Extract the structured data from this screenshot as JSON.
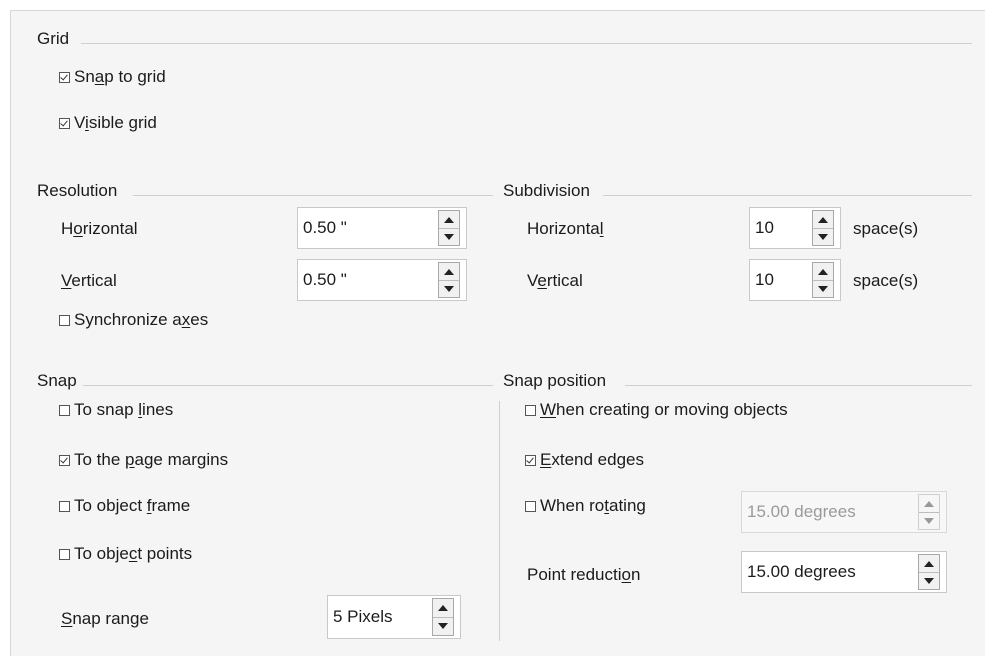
{
  "grid": {
    "title": "Grid",
    "snap_to_grid": {
      "pre": "Sn",
      "u": "a",
      "post": "p to grid",
      "checked": true
    },
    "visible_grid": {
      "pre": "V",
      "u": "i",
      "post": "sible grid",
      "checked": true
    }
  },
  "resolution": {
    "title": "Resolution",
    "horizontal": {
      "pre": "H",
      "u": "o",
      "post": "rizontal",
      "value": "0.50 \""
    },
    "vertical": {
      "pre": "",
      "u": "V",
      "post": "ertical",
      "value": "0.50 \""
    },
    "synchronize": {
      "pre": "Synchronize a",
      "u": "x",
      "post": "es",
      "checked": false
    }
  },
  "subdivision": {
    "title": "Subdivision",
    "horizontal": {
      "pre": "Horizonta",
      "u": "l",
      "post": "",
      "value": "10",
      "unit": "space(s)"
    },
    "vertical": {
      "pre": "V",
      "u": "e",
      "post": "rtical",
      "value": "10",
      "unit": "space(s)"
    }
  },
  "snap": {
    "title": "Snap",
    "snap_lines": {
      "pre": "To snap ",
      "u": "l",
      "post": "ines",
      "checked": false
    },
    "page_margins": {
      "pre": "To the ",
      "u": "p",
      "post": "age margins",
      "checked": true
    },
    "object_frame": {
      "pre": "To object ",
      "u": "f",
      "post": "rame",
      "checked": false
    },
    "object_points": {
      "pre": "To obje",
      "u": "c",
      "post": "t points",
      "checked": false
    },
    "range": {
      "pre": "",
      "u": "S",
      "post": "nap range",
      "value": "5 Pixels"
    }
  },
  "snap_position": {
    "title": "Snap position",
    "creating_moving": {
      "pre": "",
      "u": "W",
      "post": "hen creating or moving objects",
      "checked": false
    },
    "extend_edges": {
      "pre": "",
      "u": "E",
      "post": "xtend edges",
      "checked": true
    },
    "rotating": {
      "pre": "When ro",
      "u": "t",
      "post": "ating",
      "checked": false,
      "value": "15.00 degrees",
      "disabled": true
    },
    "point_reduction": {
      "pre": "Point reducti",
      "u": "o",
      "post": "n",
      "value": "15.00 degrees"
    }
  }
}
